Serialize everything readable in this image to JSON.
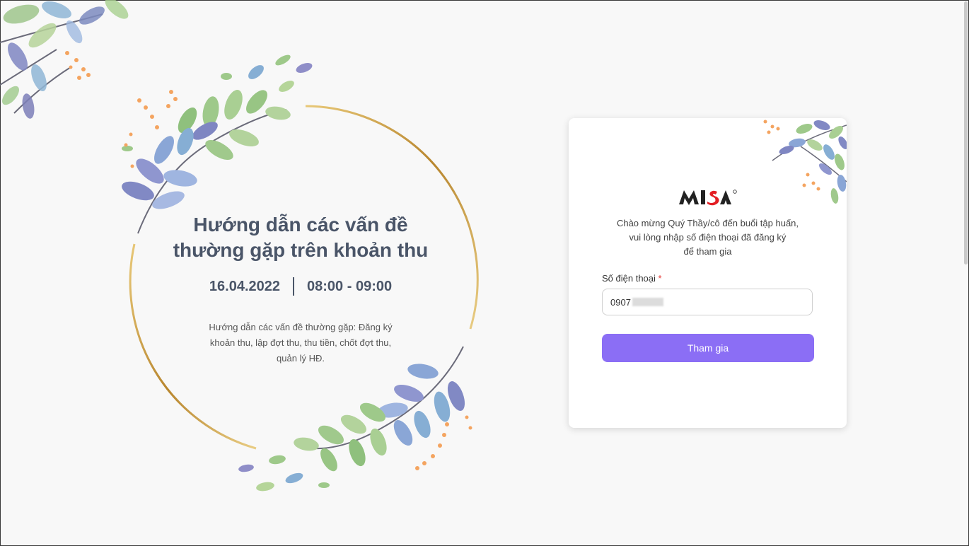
{
  "event": {
    "title_line1": "Hướng dẫn các vấn đề",
    "title_line2": "thường gặp trên khoản thu",
    "date": "16.04.2022",
    "time": "08:00 - 09:00",
    "description": "Hướng dẫn các vấn đề thường gặp: Đăng ký khoản thu, lập đợt thu, thu tiền, chốt đợt thu, quản lý HĐ."
  },
  "login": {
    "logo_text": "MISA",
    "welcome_line1": "Chào mừng Quý Thầy/cô đến buổi tập huấn,",
    "welcome_line2": "vui lòng nhập số điện thoại đã đăng ký",
    "welcome_line3": "để tham gia",
    "phone_label": "Số điện thoại",
    "required_mark": "*",
    "phone_value_visible": "0907",
    "join_button": "Tham gia"
  },
  "colors": {
    "background": "#f8f8f8",
    "title_text": "#4a5568",
    "accent_button": "#8b6ef5",
    "ring_gold": "#c8953a",
    "required_red": "#e53935",
    "logo_red": "#e31e24"
  },
  "icons": [
    "floral-corner-icon",
    "floral-branch-icon",
    "gold-ring-icon",
    "misa-logo-icon"
  ]
}
